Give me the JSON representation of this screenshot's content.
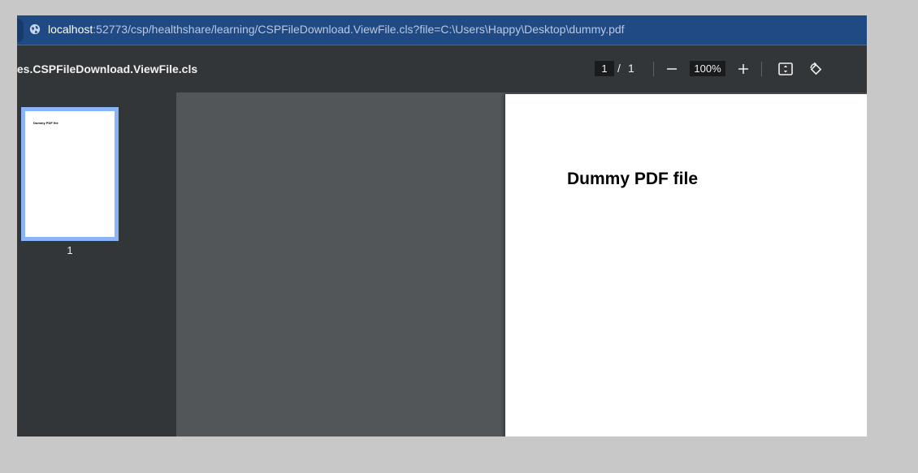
{
  "address_bar": {
    "host": "localhost",
    "path": ":52773/csp/healthshare/learning/CSPFileDownload.ViewFile.cls?file=C:\\Users\\Happy\\Desktop\\dummy.pdf",
    "icon": "globe-icon"
  },
  "toolbar": {
    "title": "les.CSPFileDownload.ViewFile.cls",
    "page_current": "1",
    "page_separator": "/",
    "page_total": "1",
    "zoom": "100%",
    "icons": [
      "minus-icon",
      "plus-icon",
      "fit-page-icon",
      "rotate-icon"
    ]
  },
  "sidebar": {
    "thumbnails": [
      {
        "label": "1",
        "preview_text": "Dummy PDF file"
      }
    ]
  },
  "document": {
    "heading": "Dummy PDF file"
  },
  "colors": {
    "address_bar_bg": "#1f4a84",
    "toolbar_bg": "#323639",
    "viewer_bg": "#525659",
    "thumbnail_selected": "#8ab4f8"
  }
}
